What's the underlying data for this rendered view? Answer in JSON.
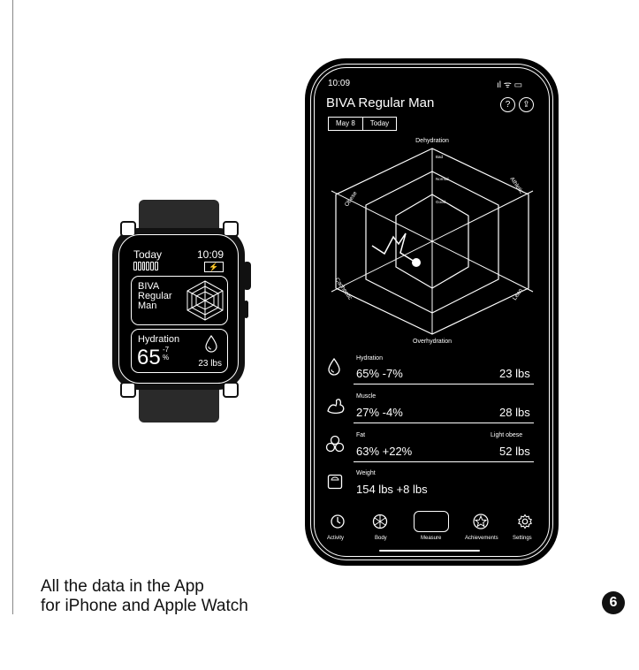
{
  "caption": {
    "line1": "All the data in the App",
    "line2": "for iPhone and Apple Watch"
  },
  "page_number": "6",
  "watch": {
    "day": "Today",
    "time": "10:09",
    "battery_icon": "bolt-icon",
    "biva_label": "BIVA Regular Man",
    "hydration": {
      "label": "Hydration",
      "value": "65",
      "delta": "-7",
      "unit": "%",
      "weight": "23 lbs"
    }
  },
  "phone": {
    "time": "10:09",
    "status": "ıl ᯤ ▭",
    "title": "BIVA Regular Man",
    "help_icon": "?",
    "share_icon": "⇪",
    "date_from": "May 8",
    "date_to": "Today",
    "chart": {
      "top": "Dehydration",
      "bottom": "Overhydration",
      "top_left": "Obese",
      "top_right": "Athletic",
      "bottom_left": "Cachectic",
      "bottom_right": "Lean",
      "ring_bad": "Bad",
      "ring_normal": "Normal",
      "ring_good": "Good"
    },
    "metrics": [
      {
        "label": "Hydration",
        "value": "65% -7%",
        "right": "23 lbs",
        "extra": ""
      },
      {
        "label": "Muscle",
        "value": "27% -4%",
        "right": "28 lbs",
        "extra": ""
      },
      {
        "label": "Fat",
        "value": "63% +22%",
        "right": "52 lbs",
        "extra": "Light obese"
      },
      {
        "label": "Weight",
        "value": "154 lbs +8 lbs",
        "right": "",
        "extra": ""
      }
    ],
    "tabs": {
      "activity": "Activity",
      "body": "Body",
      "measure": "Measure",
      "achievements": "Achievements",
      "settings": "Settings"
    }
  }
}
